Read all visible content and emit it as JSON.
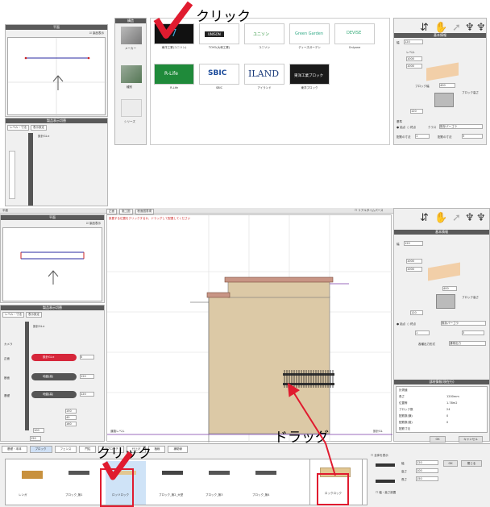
{
  "annotations": {
    "click_top": "クリック",
    "click_bottom": "クリック",
    "drag": "ドラッグ"
  },
  "top": {
    "left_header": "平面",
    "left_checkbox": "製品表示",
    "left_lower_header": "製品表示切替",
    "left_tabs": [
      "レベル・寸法",
      "表示設定"
    ],
    "left_level": "設計GL±",
    "catalog_header": "構造",
    "catalog_items": [
      "メーカー",
      "種別",
      "シリーズ"
    ],
    "thumbs": [
      {
        "logo": "7",
        "label": "東洋工業(ユニソン)"
      },
      {
        "logo": "UNISON",
        "label": "TOYO(大和工業)"
      },
      {
        "logo": "ユニソン",
        "label": "ユニソン"
      },
      {
        "logo": "Green Garden",
        "label": "ディーズガーデン"
      },
      {
        "logo": "DEVISE",
        "label": "Onlyone"
      },
      {
        "logo": "R-Life",
        "label": "R-Life"
      },
      {
        "logo": "SBIC",
        "label": "SBIC"
      },
      {
        "logo": "ILAND",
        "label": "アイランド"
      },
      {
        "logo": "東洋工業ブロック",
        "label": "東洋ブロック"
      }
    ],
    "right_header": "基本情報",
    "block_label": "ブロック幅",
    "block_height": "ブロック高さ",
    "fields": [
      {
        "label": "幅",
        "value": "120"
      },
      {
        "label": "高さ",
        "value": "1000"
      },
      {
        "label": "レベル",
        "value": "1000"
      },
      {
        "label": "",
        "value": "120"
      },
      {
        "label": "",
        "value": "400"
      },
      {
        "label": "高さ",
        "value": "120"
      },
      {
        "label": "配筋の寸法",
        "value": "1"
      },
      {
        "label": "配筋の寸法",
        "value": "3"
      }
    ],
    "dir_label": "基準",
    "dir_options": [
      "● 始点",
      "○ 終点"
    ],
    "kind_label": "クラス",
    "kind_value": "既存パーゴラ"
  },
  "bottom": {
    "left_title": "平面",
    "tabs": [
      "正面",
      "施工図",
      "断面図表現"
    ],
    "status": "設置する位置をクリックするか、ドラッグして配置してください",
    "realtime": "リアルタイムパース",
    "left_checkbox": "製品表示",
    "level_header": "製品表示切替",
    "level_tabs": [
      "レベル・寸法",
      "表示設定"
    ],
    "level_top": "設計GL±",
    "rows": [
      {
        "label": "カメラ",
        "value": "",
        "num": ""
      },
      {
        "label": "正面",
        "value": "設計GL±",
        "num": "0"
      },
      {
        "label": "断面",
        "value": "地盤(高)",
        "num": "120"
      },
      {
        "label": "基礎",
        "value": "地盤(高)",
        "num": "120"
      }
    ],
    "small_nums": [
      "150",
      "40",
      "160",
      "100",
      "150"
    ],
    "gl_left": "道路レベル",
    "gl_right": "設計GL",
    "right_header": "基本情報",
    "right_extra_label": "各種出力形式",
    "right_extra_value": "通常出力",
    "detail_header": "部材情報(現在行)",
    "detail_rows": [
      {
        "k": "計測値",
        "v": ""
      },
      {
        "k": "長さ",
        "v": "1200mm"
      },
      {
        "k": "位置等",
        "v": "1.78m2"
      },
      {
        "k": "ブロック数",
        "v": "24"
      },
      {
        "k": "配筋数(横)",
        "v": "0"
      },
      {
        "k": "配筋数(縦)",
        "v": "0"
      },
      {
        "k": "配筋寸法",
        "v": ""
      }
    ],
    "ok": "OK",
    "cancel": "キャンセル",
    "bottom_tabs": [
      "基礎・本体",
      "ブロック",
      "フェンス",
      "門柱",
      "アプローチ",
      "仕上げ",
      "植栽",
      "補助線"
    ],
    "bottom_check": "全体を表示",
    "parts": [
      {
        "label": "レンガ"
      },
      {
        "label": "ブロック_無1"
      },
      {
        "label": "ロッソロック"
      },
      {
        "label": "ブロック_無2_大型"
      },
      {
        "label": "ブロック_無3"
      },
      {
        "label": "ブロック_無4"
      }
    ],
    "parts_right": {
      "label": "ロックロック"
    },
    "props": [
      {
        "k": "幅",
        "v": "120"
      },
      {
        "k": "高さ",
        "v": "100"
      },
      {
        "k": "長さ",
        "v": "150"
      }
    ],
    "props_check": "幅・高さ設置",
    "ok_btn": "OK",
    "cancel_btn": "閉じる"
  },
  "colors": {
    "accent": "#d6263a",
    "header": "#5a5a5a",
    "wall": "#dcc9a6",
    "cap": "#c89585"
  }
}
